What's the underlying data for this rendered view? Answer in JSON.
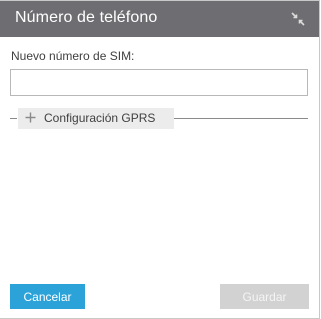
{
  "dialog": {
    "title": "Número de teléfono",
    "collapse_icon": "collapse-arrows-icon"
  },
  "form": {
    "sim_label": "Nuevo número de SIM:",
    "sim_value": "",
    "sim_placeholder": "",
    "gprs_section": {
      "icon": "plus-icon",
      "label": "Configuración GPRS",
      "expanded": false
    }
  },
  "buttons": {
    "cancel_label": "Cancelar",
    "save_label": "Guardar",
    "save_enabled": false
  },
  "colors": {
    "titlebar": "#6e6e72",
    "primary": "#2ba3d9",
    "disabled": "#d2d2d2"
  }
}
